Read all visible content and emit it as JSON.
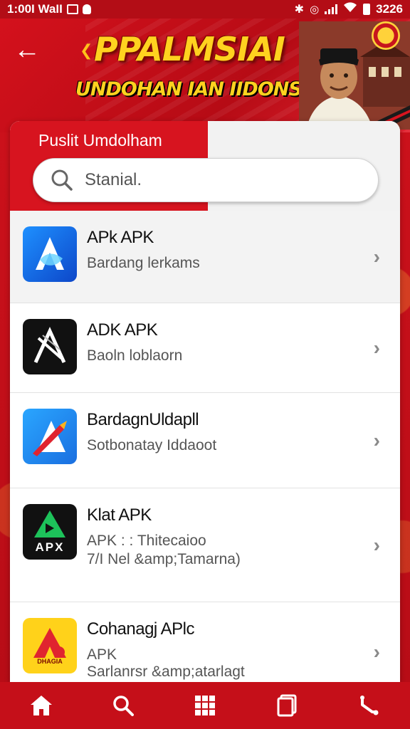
{
  "status_bar": {
    "time_carrier": "1:00I WaII",
    "battery_text": "3226"
  },
  "header": {
    "title": "PPALMSIAI",
    "subtitle": "UNDOHAN IAN IIDONSIA"
  },
  "card": {
    "title": "Puslit Umdolham",
    "search_placeholder": "Stanial."
  },
  "apps": [
    {
      "name": "APk APK",
      "desc_lines": [
        "Bardang lerkams"
      ],
      "icon": "app-icon-blue-a",
      "color": "#1f6fe0"
    },
    {
      "name": "ADK APK",
      "desc_lines": [
        "Baoln loblaorn"
      ],
      "icon": "app-icon-black-a",
      "color": "#111111"
    },
    {
      "name": "BardagnUldapll",
      "desc_lines": [
        "Sotbonatay Iddaoot"
      ],
      "icon": "app-icon-rocket",
      "color": "#1c8ff0"
    },
    {
      "name": "Klat APK",
      "desc_lines": [
        "APK : : Thitecaioo",
        "7/I Nel &amp;Tamarna)"
      ],
      "icon": "app-icon-green-apx",
      "icon_label": "APX",
      "color": "#16b04a"
    },
    {
      "name": "Cohanagj APlc",
      "desc_lines": [
        "APK",
        "Sarlanrsr &amp;atarlagt"
      ],
      "icon": "app-icon-yellow-a",
      "icon_label": "DHAGIA",
      "color": "#ffd21a"
    }
  ],
  "bottom_nav": [
    "home-icon",
    "search-icon",
    "grid-icon",
    "pages-icon",
    "tools-icon"
  ]
}
